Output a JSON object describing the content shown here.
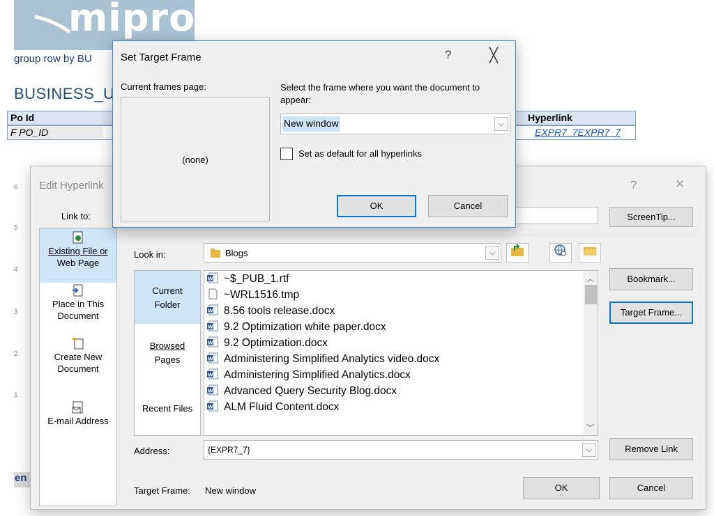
{
  "background_doc": {
    "logo_text": "mipro",
    "caption": "group row by BU",
    "heading": "BUSINESS_U",
    "table_headers": {
      "col1": "Po Id",
      "col_last": "Hyperlink"
    },
    "table_row": {
      "col1": "F PO_ID",
      "col_last": "EXPR7_7EXPR7_7"
    },
    "side_numbers": [
      "6",
      "5",
      "4",
      "3",
      "2",
      "1"
    ],
    "footer_fragment": "en"
  },
  "edit_hyperlink": {
    "title": "Edit Hyperlink",
    "help_glyph": "?",
    "close_glyph": "✕",
    "link_to_label": "Link to:",
    "link_to_items": [
      {
        "line1": "Existing File or",
        "line2": "Web Page",
        "icon": "existing-file-icon",
        "selected": true
      },
      {
        "line1": "Place in This",
        "line2": "Document",
        "icon": "place-in-document-icon",
        "selected": false
      },
      {
        "line1": "Create New",
        "line2": "Document",
        "icon": "create-new-document-icon",
        "selected": false
      },
      {
        "line1": "E-mail Address",
        "line2": "",
        "icon": "email-address-icon",
        "selected": false
      }
    ],
    "screentip_label": "ScreenTip...",
    "look_in_label": "Look in:",
    "look_in_value": "Blogs",
    "folder_tabs": [
      {
        "line1": "Current",
        "line2": "Folder",
        "selected": true
      },
      {
        "line1": "Browsed",
        "line2": "Pages",
        "selected": false
      },
      {
        "line1": "Recent Files",
        "line2": "",
        "selected": false
      }
    ],
    "files": [
      {
        "name": "~$_PUB_1.rtf",
        "icon": "word-doc-icon"
      },
      {
        "name": "~WRL1516.tmp",
        "icon": "blank-file-icon"
      },
      {
        "name": "8.56 tools release.docx",
        "icon": "word-doc-icon"
      },
      {
        "name": "9.2 Optimization white paper.docx",
        "icon": "word-doc-icon"
      },
      {
        "name": "9.2 Optimization.docx",
        "icon": "word-doc-icon"
      },
      {
        "name": "Administering Simplified Analytics video.docx",
        "icon": "word-doc-icon"
      },
      {
        "name": "Administering Simplified Analytics.docx",
        "icon": "word-doc-icon"
      },
      {
        "name": "Advanced Query Security Blog.docx",
        "icon": "word-doc-icon"
      },
      {
        "name": "ALM Fluid Content.docx",
        "icon": "word-doc-icon"
      }
    ],
    "bookmark_label": "Bookmark...",
    "target_frame_label": "Target Frame...",
    "address_label": "Address:",
    "address_value": "{EXPR7_7}",
    "remove_link_label": "Remove Link",
    "target_frame_caption": "Target Frame:",
    "target_frame_value": "New window",
    "ok_label": "OK",
    "cancel_label": "Cancel"
  },
  "set_target_frame": {
    "title": "Set Target Frame",
    "help_glyph": "?",
    "close_glyph": "╳",
    "current_frames_label": "Current frames page:",
    "frames_preview": "(none)",
    "select_label": "Select the frame where you want the document to appear:",
    "frame_value": "New window",
    "default_checkbox_label": "Set as default for all hyperlinks",
    "default_checked": false,
    "ok_label": "OK",
    "cancel_label": "Cancel"
  },
  "colors": {
    "selection_blue": "#cde5f7",
    "focus_border": "#0078d7",
    "logo_bg": "#a8c2d4",
    "link_blue": "#1155cc",
    "dialog_bg": "#f0f0f0"
  }
}
